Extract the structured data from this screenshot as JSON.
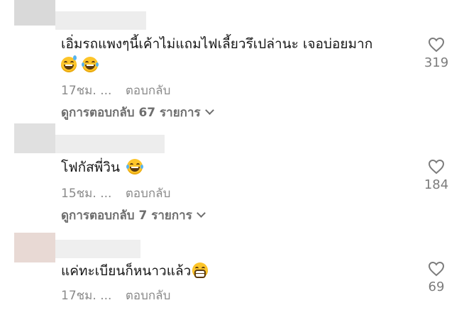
{
  "comments": [
    {
      "text": "เอิ่มรถแพงๆนี้เค้าไม่แถมไฟเลี้ยวรึเปล่านะ เจอบ่อยมาก",
      "emojis": [
        "grinning-sweat-emoji",
        "tears-of-joy-emoji"
      ],
      "time": "17ชม.",
      "dots": "...",
      "reply_label": "ตอบกลับ",
      "view_replies": "ดูการตอบกลับ 67 รายการ",
      "likes": "319",
      "avatar_color": "#d9d9d9"
    },
    {
      "text": "โฟกัสพี่วิน",
      "emojis": [
        "tears-of-joy-emoji"
      ],
      "time": "15ชม.",
      "dots": "...",
      "reply_label": "ตอบกลับ",
      "view_replies": "ดูการตอบกลับ 7 รายการ",
      "likes": "184",
      "avatar_color": "#e0e0e0"
    },
    {
      "text": "แค่ทะเบียนก็หนาวแล้ว",
      "emojis": [
        "grimacing-emoji"
      ],
      "time": "17ชม.",
      "dots": "...",
      "reply_label": "ตอบกลับ",
      "likes": "69",
      "avatar_color": "#e8d9d4"
    }
  ],
  "icons": {
    "like": "heart-outline-icon",
    "expand": "chevron-down-icon"
  },
  "colors": {
    "text": "#161616",
    "meta": "#8a8a8a",
    "count": "#7c7c7c"
  }
}
